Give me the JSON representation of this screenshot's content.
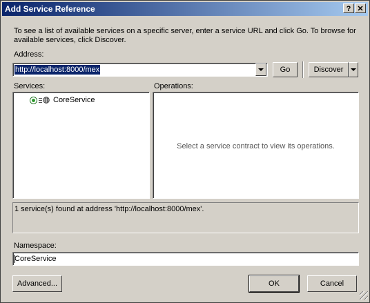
{
  "window": {
    "title": "Add Service Reference",
    "help_glyph": "?",
    "close_glyph": "✕"
  },
  "description": "To see a list of available services on a specific server, enter a service URL and click Go. To browse for available services, click Discover.",
  "address": {
    "label": "Address:",
    "value": "http://localhost:8000/mex",
    "go_label": "Go",
    "discover_label": "Discover"
  },
  "services": {
    "label": "Services:",
    "items": [
      {
        "name": "CoreService"
      }
    ]
  },
  "operations": {
    "label": "Operations:",
    "hint": "Select a service contract to view its operations."
  },
  "status_text": "1 service(s) found at address 'http://localhost:8000/mex'.",
  "namespace": {
    "label": "Namespace:",
    "value": "CoreService"
  },
  "buttons": {
    "advanced": "Advanced...",
    "ok": "OK",
    "cancel": "Cancel"
  },
  "colors": {
    "titlebar_start": "#0a246a",
    "titlebar_end": "#a6caf0",
    "dialog_bg": "#d4d0c8",
    "selection": "#0a246a"
  }
}
